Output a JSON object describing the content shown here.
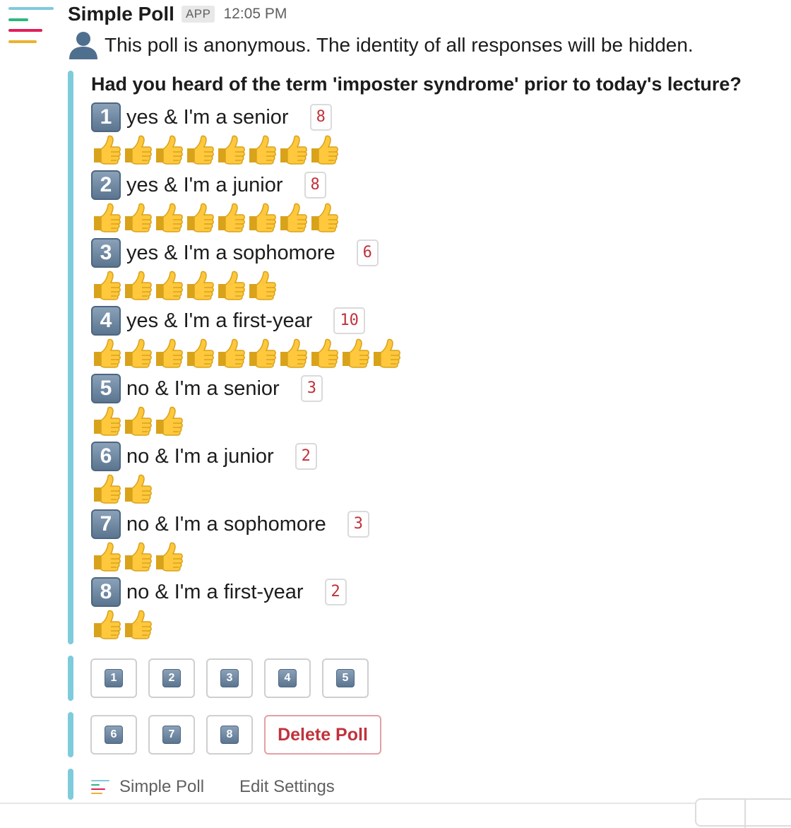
{
  "message": {
    "sender": "Simple Poll",
    "badge": "APP",
    "time": "12:05 PM",
    "anon_text": "This poll is anonymous. The identity of all responses will be hidden."
  },
  "poll": {
    "question": "Had you heard of the term 'imposter syndrome' prior to today's lecture?",
    "options": [
      {
        "num": "1",
        "label": "yes & I'm a senior",
        "count": "8",
        "votes": 8
      },
      {
        "num": "2",
        "label": "yes & I'm a junior",
        "count": "8",
        "votes": 8
      },
      {
        "num": "3",
        "label": "yes & I'm a sophomore",
        "count": "6",
        "votes": 6
      },
      {
        "num": "4",
        "label": "yes & I'm a first-year",
        "count": "10",
        "votes": 10
      },
      {
        "num": "5",
        "label": "no & I'm a senior",
        "count": "3",
        "votes": 3
      },
      {
        "num": "6",
        "label": "no & I'm a junior",
        "count": "2",
        "votes": 2
      },
      {
        "num": "7",
        "label": "no & I'm a sophomore",
        "count": "3",
        "votes": 3
      },
      {
        "num": "8",
        "label": "no & I'm a first-year",
        "count": "2",
        "votes": 2
      }
    ]
  },
  "buttons": {
    "vote": [
      "1",
      "2",
      "3",
      "4",
      "5",
      "6",
      "7",
      "8"
    ],
    "delete": "Delete Poll"
  },
  "footer": {
    "app_name": "Simple Poll",
    "edit": "Edit Settings"
  },
  "icons": {
    "avatar": "simple-poll-logo-icon",
    "anon": "bust-in-silhouette-icon",
    "vote_mark": "thumbs-up-icon",
    "option_number": "keycap-digit-icon"
  },
  "colors": {
    "accent_bar": "#7ecbdc",
    "count_text": "#c0323c",
    "delete": "#c0323c",
    "logo": [
      "#7ecbdc",
      "#2eb67d",
      "#e01e5a",
      "#ecb22e"
    ]
  }
}
